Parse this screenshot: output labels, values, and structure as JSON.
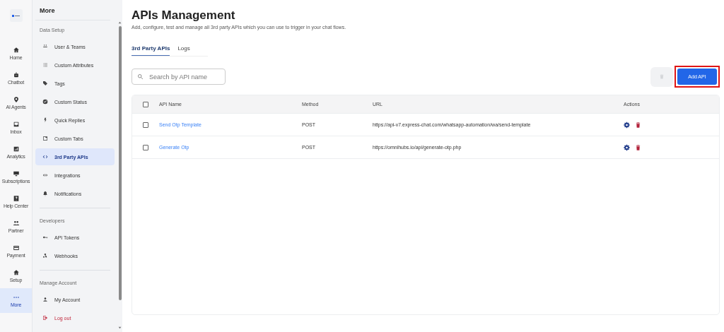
{
  "rail": {
    "items": [
      {
        "label": "Home",
        "selected": false
      },
      {
        "label": "Chatbot",
        "selected": false
      },
      {
        "label": "AI Agents",
        "selected": false
      },
      {
        "label": "Inbox",
        "selected": false
      },
      {
        "label": "Analytics",
        "selected": false
      },
      {
        "label": "Subscriptions",
        "selected": false
      },
      {
        "label": "Help Center",
        "selected": false
      },
      {
        "label": "Partner",
        "selected": false
      },
      {
        "label": "Payment",
        "selected": false
      },
      {
        "label": "Setup",
        "selected": false
      },
      {
        "label": "More",
        "selected": true
      }
    ]
  },
  "sidebar": {
    "title": "More",
    "sections": [
      {
        "heading": "Data Setup",
        "items": [
          {
            "label": "User & Teams",
            "selected": false,
            "danger": false
          },
          {
            "label": "Custom Attributes",
            "selected": false,
            "danger": false
          },
          {
            "label": "Tags",
            "selected": false,
            "danger": false
          },
          {
            "label": "Custom Status",
            "selected": false,
            "danger": false
          },
          {
            "label": "Quick Replies",
            "selected": false,
            "danger": false
          },
          {
            "label": "Custom Tabs",
            "selected": false,
            "danger": false
          },
          {
            "label": "3rd Party APIs",
            "selected": true,
            "danger": false
          },
          {
            "label": "Integrations",
            "selected": false,
            "danger": false
          },
          {
            "label": "Notifications",
            "selected": false,
            "danger": false
          }
        ]
      },
      {
        "heading": "Developers",
        "items": [
          {
            "label": "API Tokens",
            "selected": false,
            "danger": false
          },
          {
            "label": "Webhooks",
            "selected": false,
            "danger": false
          }
        ]
      },
      {
        "heading": "Manage Account",
        "items": [
          {
            "label": "My Account",
            "selected": false,
            "danger": false
          },
          {
            "label": "Log out",
            "selected": false,
            "danger": true
          }
        ]
      }
    ]
  },
  "page": {
    "title": "APIs Management",
    "subtitle": "Add, configure, test and manage all 3rd party APIs which you can use to trigger in your chat flows."
  },
  "tabs": [
    {
      "label": "3rd Party APIs",
      "selected": true
    },
    {
      "label": "Logs",
      "selected": false
    }
  ],
  "search": {
    "placeholder": "Search by API name"
  },
  "toolbar": {
    "delete_disabled": true,
    "add_label": "Add API",
    "add_highlighted": true
  },
  "table": {
    "select_all_checked": false,
    "columns": [
      "API Name",
      "Method",
      "URL",
      "Actions"
    ],
    "rows": [
      {
        "checked": false,
        "name": "Send Otp Template",
        "method": "POST",
        "url": "https://api-v7.express-chat.com/whatsapp-automation/wa/send-template"
      },
      {
        "checked": false,
        "name": "Generate Otp",
        "method": "POST",
        "url": "https://omnihubs.io/api/generate-otp.php"
      }
    ]
  }
}
